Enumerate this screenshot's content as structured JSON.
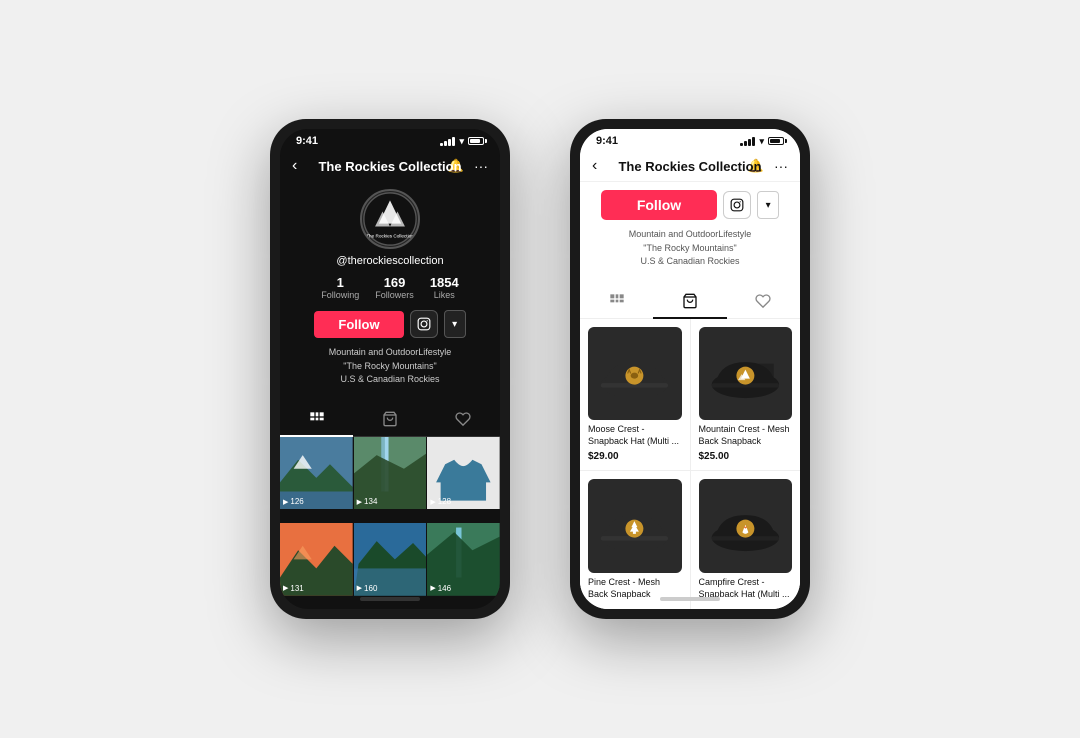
{
  "scene": {
    "bg_color": "#f0f0f0"
  },
  "phone1": {
    "status": {
      "time": "9:41",
      "theme": "dark"
    },
    "nav": {
      "back": "‹",
      "title": "The Rockies Collection",
      "bell": "🔔",
      "more": "···"
    },
    "profile": {
      "username": "@therockiescollection",
      "stats": [
        {
          "num": "1",
          "label": "Following"
        },
        {
          "num": "169",
          "label": "Followers"
        },
        {
          "num": "1854",
          "label": "Likes"
        }
      ],
      "follow_label": "Follow",
      "bio": "Mountain and OutdoorLifestyle\n\"The Rocky Mountains\"\nU.S & Canadian Rockies"
    },
    "tabs": [
      "grid",
      "shop",
      "heart"
    ],
    "videos": [
      {
        "count": "126"
      },
      {
        "count": "134"
      },
      {
        "count": "128"
      },
      {
        "count": "131"
      },
      {
        "count": "160"
      },
      {
        "count": "146"
      }
    ]
  },
  "phone2": {
    "status": {
      "time": "9:41",
      "theme": "light"
    },
    "nav": {
      "back": "‹",
      "title": "The Rockies Collection",
      "bell": "🔔",
      "more": "···"
    },
    "profile": {
      "follow_label": "Follow",
      "bio": "Mountain and OutdoorLifestyle\n\"The Rocky Mountains\"\nU.S & Canadian Rockies"
    },
    "tabs": [
      "grid",
      "shop",
      "heart"
    ],
    "products": [
      {
        "name": "Moose Crest -\nSnapback Hat (Multi ...",
        "price": "$29.00",
        "icon": "moose"
      },
      {
        "name": "Mountain Crest - Mesh\nBack Snapback",
        "price": "$25.00",
        "icon": "mountain"
      },
      {
        "name": "Pine Crest - Mesh\nBack Snapback",
        "price": "",
        "icon": "pine"
      },
      {
        "name": "Campfire Crest -\nSnapback Hat (Multi ...",
        "price": "",
        "icon": "campfire"
      }
    ]
  }
}
